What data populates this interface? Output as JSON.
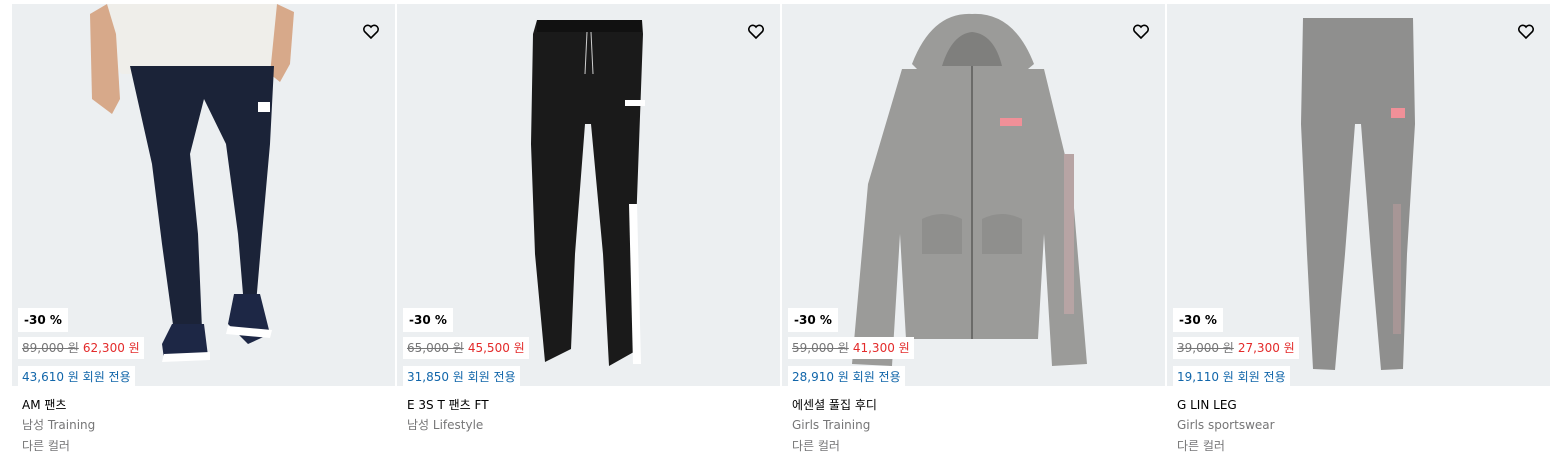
{
  "products": [
    {
      "discount": "-30 %",
      "original_price": "89,000 원",
      "sale_price": "62,300 원",
      "member_price": "43,610 원 회원 전용",
      "name": "AM 팬츠",
      "category": "남성 Training",
      "colors": "다른 컬러",
      "image": "navy-training-pants-model"
    },
    {
      "discount": "-30 %",
      "original_price": "65,000 원",
      "sale_price": "45,500 원",
      "member_price": "31,850 원 회원 전용",
      "name": "E 3S T 팬츠 FT",
      "category": "남성 Lifestyle",
      "colors": "",
      "image": "black-track-pants"
    },
    {
      "discount": "-30 %",
      "original_price": "59,000 원",
      "sale_price": "41,300 원",
      "member_price": "28,910 원 회원 전용",
      "name": "에센셜 풀집 후디",
      "category": "Girls Training",
      "colors": "다른 컬러",
      "image": "grey-zip-hoodie"
    },
    {
      "discount": "-30 %",
      "original_price": "39,000 원",
      "sale_price": "27,300 원",
      "member_price": "19,110 원 회원 전용",
      "name": "G LIN LEG",
      "category": "Girls sportswear",
      "colors": "다른 컬러",
      "image": "grey-leggings"
    }
  ],
  "colors": {
    "image_bg": "#eceff1",
    "sale": "#e32b2b",
    "member": "#1166aa",
    "muted": "#767677"
  },
  "icons": {
    "wishlist": "heart-outline-icon"
  }
}
